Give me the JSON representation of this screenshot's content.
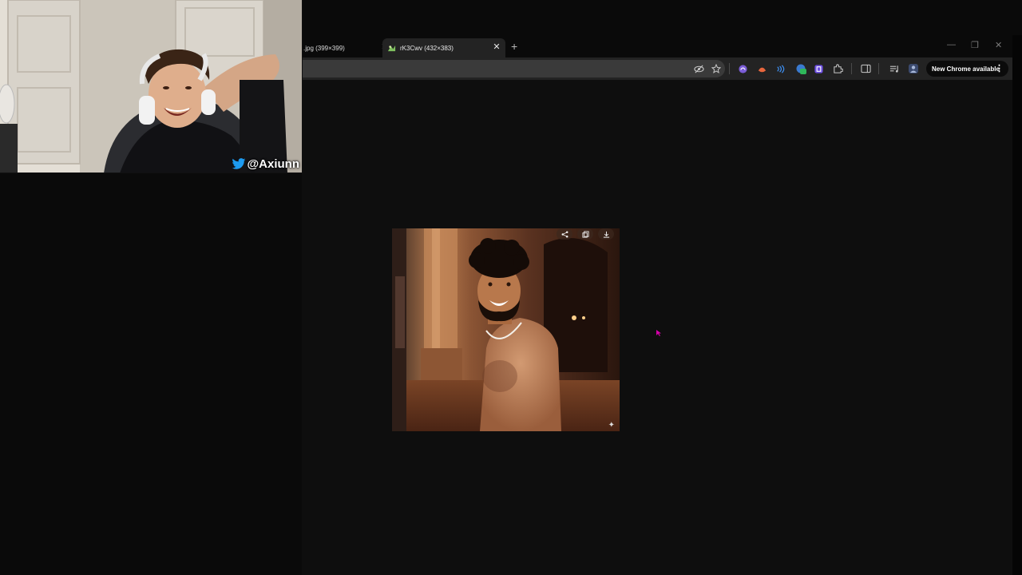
{
  "browser": {
    "tabs": [
      {
        "title": ".jpg (399×399)",
        "active": false
      },
      {
        "title": "rK3Cwv (432×383)",
        "active": true
      }
    ],
    "new_tab_glyph": "+",
    "update_button": "New Chrome available",
    "toolbar_icons": [
      "eye-off-icon",
      "star-icon",
      "extension-icon-purple",
      "extension-icon-orange",
      "extension-icon-blue",
      "extension-icon-green",
      "extension-icon-violet",
      "puzzle-icon",
      "sidebar-icon",
      "media-icon",
      "profile-icon"
    ]
  },
  "webcam": {
    "handle": "@Axiunn"
  },
  "colors": {
    "page_bg": "#0e0e0e",
    "toolbar_bg": "#232323",
    "twitter_blue": "#1d9bf0",
    "cursor": "#d400a8"
  }
}
